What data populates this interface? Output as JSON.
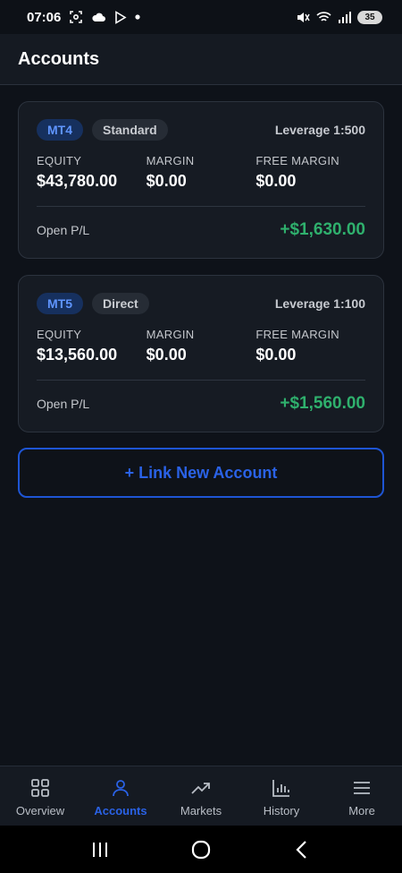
{
  "status_bar": {
    "time": "07:06",
    "battery": "35",
    "icons": [
      "screenshot-icon",
      "cloud-icon",
      "play-icon",
      "dot-icon",
      "mute-icon",
      "wifi-icon",
      "signal-icon",
      "battery-icon"
    ]
  },
  "header": {
    "title": "Accounts"
  },
  "accounts": [
    {
      "platform": "MT4",
      "type": "Standard",
      "leverage": "Leverage 1:500",
      "equity_label": "EQUITY",
      "equity": "$43,780.00",
      "margin_label": "MARGIN",
      "margin": "$0.00",
      "free_margin_label": "FREE MARGIN",
      "free_margin": "$0.00",
      "pl_label": "Open P/L",
      "pl": "+$1,630.00"
    },
    {
      "platform": "MT5",
      "type": "Direct",
      "leverage": "Leverage 1:100",
      "equity_label": "EQUITY",
      "equity": "$13,560.00",
      "margin_label": "MARGIN",
      "margin": "$0.00",
      "free_margin_label": "FREE MARGIN",
      "free_margin": "$0.00",
      "pl_label": "Open P/L",
      "pl": "+$1,560.00"
    }
  ],
  "link_button": {
    "label": "+ Link New Account"
  },
  "bottom_nav": {
    "active": "Accounts",
    "items": [
      {
        "label": "Overview",
        "icon": "grid-icon"
      },
      {
        "label": "Accounts",
        "icon": "user-icon"
      },
      {
        "label": "Markets",
        "icon": "trending-up-icon"
      },
      {
        "label": "History",
        "icon": "bar-chart-icon"
      },
      {
        "label": "More",
        "icon": "menu-icon"
      }
    ]
  },
  "colors": {
    "background": "#0e1219",
    "card": "#161b23",
    "accent": "#2a62e6",
    "profit": "#2fb06d",
    "platform_badge": "#16305e"
  }
}
